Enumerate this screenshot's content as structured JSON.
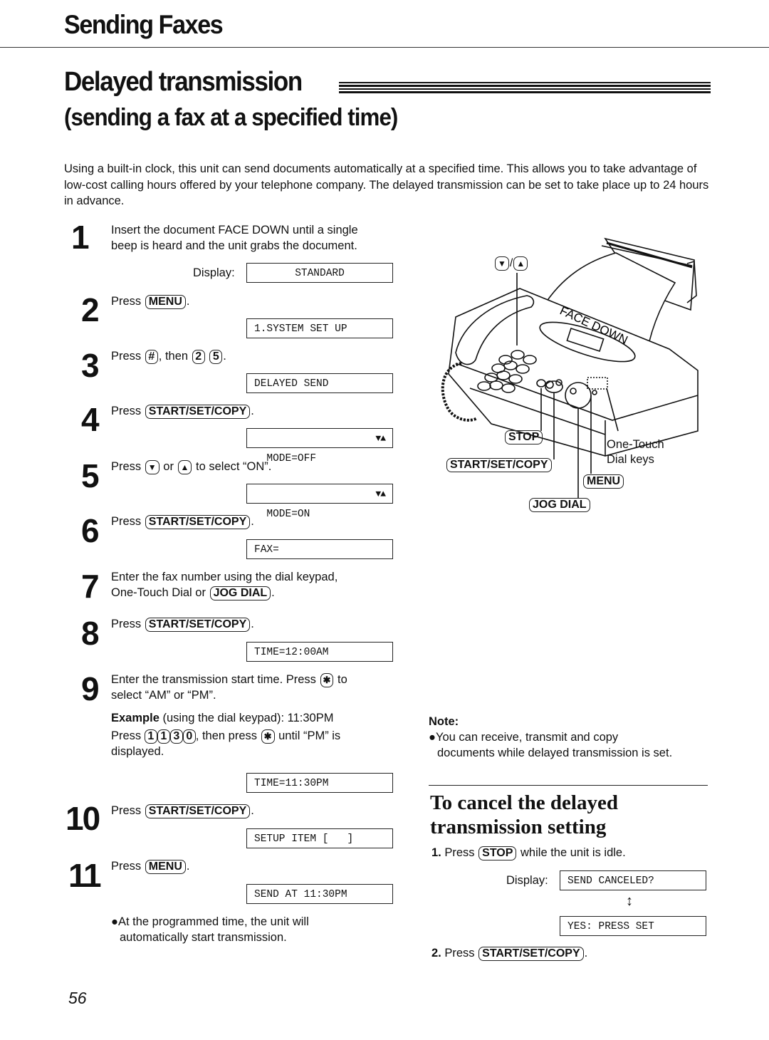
{
  "header": {
    "section": "Sending Faxes",
    "title": "Delayed transmission",
    "subtitle": "(sending a fax at a specified time)"
  },
  "intro": "Using a built-in clock, this unit can send documents automatically at a specified time. This allows you to take advantage of low-cost calling hours offered by your telephone company. The delayed transmission can be set to take place up to 24 hours in advance.",
  "common": {
    "press": "Press",
    "display_label": "Display:",
    "period": ".",
    "comma_then": ", then",
    "or": "or",
    "to_select_on": "to select “ON”."
  },
  "keys": {
    "menu": "MENU",
    "start_set_copy": "START/SET/COPY",
    "jog_dial": "JOG DIAL",
    "stop": "STOP",
    "hash": "#",
    "two": "2",
    "five": "5",
    "down": "▼",
    "up": "▲",
    "star": "✱",
    "one": "1",
    "three": "3",
    "zero": "0"
  },
  "steps": [
    {
      "num": "1",
      "text_line1": "Insert the document FACE DOWN until a single",
      "text_line2": "beep is heard and the unit grabs the document.",
      "display": "STANDARD"
    },
    {
      "num": "2",
      "display": "1.SYSTEM SET UP"
    },
    {
      "num": "3",
      "display": "DELAYED SEND"
    },
    {
      "num": "4",
      "display": "MODE=OFF",
      "display_arrows": "▼▲"
    },
    {
      "num": "5",
      "display": "MODE=ON",
      "display_arrows": "▼▲"
    },
    {
      "num": "6",
      "display": "FAX="
    },
    {
      "num": "7",
      "text_line1": "Enter the fax number using the dial keypad,",
      "text_line2": "One-Touch Dial or"
    },
    {
      "num": "8",
      "display": "TIME=12:00AM"
    },
    {
      "num": "9",
      "text_line1": "Enter the transmission start time. Press",
      "text_line1_end": "to",
      "text_line2": "select “AM” or “PM”.",
      "example_label": "Example",
      "example_text": "(using the dial keypad):  11:30PM",
      "example_press_suffix": ", then press",
      "example_until": "until “PM” is",
      "example_line3": "displayed.",
      "display": "TIME=11:30PM"
    },
    {
      "num": "10",
      "display": "SETUP ITEM [   ]"
    },
    {
      "num": "11",
      "display": "SEND AT 11:30PM",
      "bullet_line1": "●At the programmed time, the unit will",
      "bullet_line2": "automatically start transmission."
    }
  ],
  "diagram": {
    "paper_text": "FACE DOWN",
    "labels": {
      "up_down": "▼/▲",
      "stop": "STOP",
      "start_set_copy": "START/SET/COPY",
      "one_touch_line1": "One-Touch",
      "one_touch_line2": "Dial keys",
      "menu": "MENU",
      "jog_dial": "JOG DIAL"
    }
  },
  "note": {
    "title": "Note:",
    "line1": "●You can receive, transmit and copy",
    "line2": "documents while delayed transmission is set."
  },
  "cancel": {
    "title_line1": "To cancel the delayed",
    "title_line2": "transmission setting",
    "step1_num": "1.",
    "step1_suffix": "while the unit is idle.",
    "display1": "SEND CANCELED?",
    "swap_arrow": "↕",
    "display2": "YES: PRESS SET",
    "step2_num": "2."
  },
  "footer": {
    "page_number": "56"
  }
}
